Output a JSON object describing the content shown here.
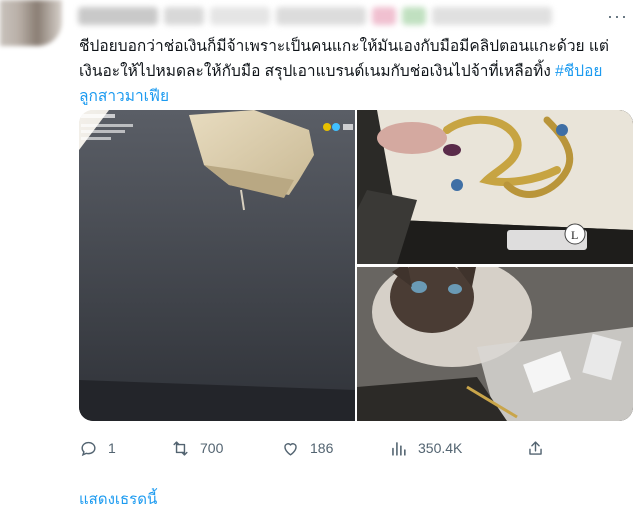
{
  "tweet": {
    "text_main": "ชีปอยบอกว่าช่อเงินก็มีจ้าเพราะเป็นคนแกะให้มันเองกับมือมีคลิปตอนแกะด้วย แต่เงินอะให้ไปหมดละให้กับมือ สรุปเอาแบรนด์เนมกับช่อเงินไปจ้าที่เหลือทิ้ง ",
    "hashtag": "#ชีปอยลูกสาวมาเฟีย"
  },
  "actions": {
    "replies": "1",
    "retweets": "700",
    "likes": "186",
    "views": "350.4K"
  },
  "show_thread": "แสดงเธรดนี้",
  "colors": {
    "accent": "#1d9bf0",
    "muted": "#536471"
  }
}
